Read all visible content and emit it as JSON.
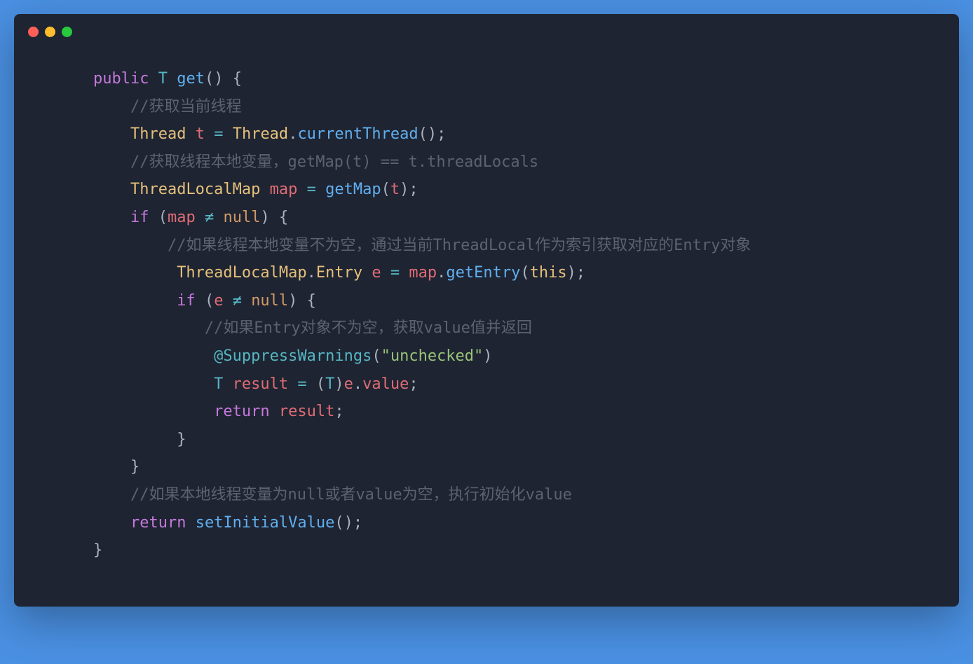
{
  "window": {
    "dots": {
      "red": "#ff5f56",
      "yellow": "#ffbd2e",
      "green": "#27c93f"
    }
  },
  "code": {
    "line1": {
      "indent": "    ",
      "public": "public",
      "sp1": " ",
      "type": "T",
      "sp2": " ",
      "method": "get",
      "parens": "()",
      "sp3": " ",
      "brace": "{"
    },
    "line2": {
      "indent": "        ",
      "comment": "//获取当前线程"
    },
    "line3": {
      "indent": "        ",
      "class": "Thread",
      "sp1": " ",
      "var": "t",
      "sp2": " ",
      "eq": "=",
      "sp3": " ",
      "class2": "Thread",
      "dot": ".",
      "method": "currentThread",
      "parens": "();"
    },
    "line4": {
      "indent": "        ",
      "comment": "//获取线程本地变量，getMap(t) == t.threadLocals"
    },
    "line5": {
      "indent": "        ",
      "class": "ThreadLocalMap",
      "sp1": " ",
      "var": "map",
      "sp2": " ",
      "eq": "=",
      "sp3": " ",
      "method": "getMap",
      "paren_open": "(",
      "arg": "t",
      "paren_close": ");"
    },
    "line6": {
      "indent": "        ",
      "if": "if",
      "sp1": " ",
      "paren_open": "(",
      "var": "map",
      "sp2": " ",
      "neq": "≠",
      "sp3": " ",
      "null": "null",
      "paren_close": ")",
      "sp4": " ",
      "brace": "{"
    },
    "line7": {
      "indent": "            ",
      "comment": "//如果线程本地变量不为空，通过当前ThreadLocal作为索引获取对应的Entry对象"
    },
    "line8": {
      "indent": "             ",
      "class": "ThreadLocalMap",
      "dot": ".",
      "class2": "Entry",
      "sp1": " ",
      "var": "e",
      "sp2": " ",
      "eq": "=",
      "sp3": " ",
      "obj": "map",
      "dot2": ".",
      "method": "getEntry",
      "paren_open": "(",
      "this": "this",
      "paren_close": ");"
    },
    "line9": {
      "indent": "             ",
      "if": "if",
      "sp1": " ",
      "paren_open": "(",
      "var": "e",
      "sp2": " ",
      "neq": "≠",
      "sp3": " ",
      "null": "null",
      "paren_close": ")",
      "sp4": " ",
      "brace": "{"
    },
    "line10": {
      "indent": "                ",
      "comment": "//如果Entry对象不为空，获取value值并返回"
    },
    "line11": {
      "indent": "                 ",
      "at": "@",
      "annotation": "SuppressWarnings",
      "paren_open": "(",
      "string": "\"unchecked\"",
      "paren_close": ")"
    },
    "line12": {
      "indent": "                 ",
      "type": "T",
      "sp1": " ",
      "var": "result",
      "sp2": " ",
      "eq": "=",
      "sp3": " ",
      "paren_open": "(",
      "type2": "T",
      "paren_close": ")",
      "obj": "e",
      "dot": ".",
      "prop": "value",
      "semi": ";"
    },
    "line13": {
      "indent": "                 ",
      "return": "return",
      "sp1": " ",
      "var": "result",
      "semi": ";"
    },
    "line14": {
      "indent": "             ",
      "brace": "}"
    },
    "line15": {
      "indent": "        ",
      "brace": "}"
    },
    "line16": {
      "indent": "        ",
      "comment": "//如果本地线程变量为null或者value为空，执行初始化value"
    },
    "line17": {
      "indent": "        ",
      "return": "return",
      "sp1": " ",
      "method": "setInitialValue",
      "parens": "();"
    },
    "line18": {
      "indent": "    ",
      "brace": "}"
    }
  }
}
